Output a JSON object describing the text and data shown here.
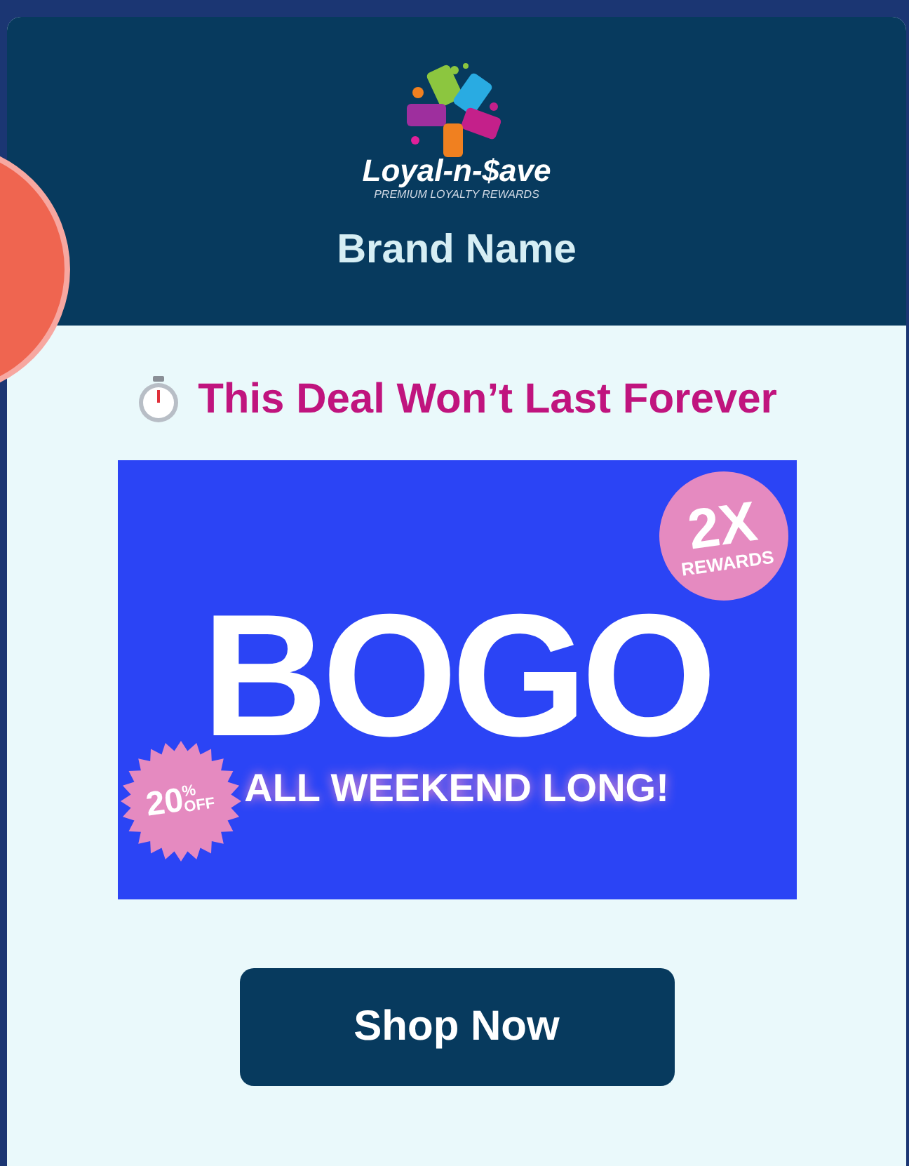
{
  "header": {
    "logo": {
      "name": "Loyal-n-$ave",
      "tagline": "PREMIUM LOYALTY REWARDS"
    },
    "brand_name": "Brand Name"
  },
  "headline": "This Deal Won’t Last Forever",
  "banner": {
    "title": "BOGO",
    "subtitle": "ALL WEEKEND LONG!",
    "multiplier_badge": {
      "value": "2X",
      "label": "REWARDS"
    },
    "discount_badge": {
      "value": "20",
      "percent": "%",
      "label": "OFF"
    }
  },
  "button": {
    "label": "Shop Now"
  }
}
